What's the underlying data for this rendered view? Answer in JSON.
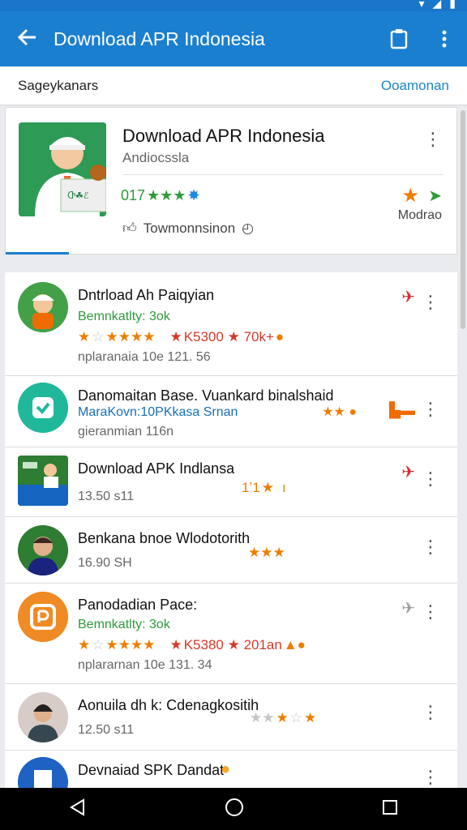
{
  "app_bar": {
    "title": "Download APR Indonesia"
  },
  "subbar": {
    "left": "Sageykanars",
    "right": "Ooamonan"
  },
  "featured": {
    "title": "Download APR Indonesia",
    "subtitle": "Andiocssla",
    "rating_text": "017",
    "meta_text": "Towmonnsinon",
    "action_label": "Modrao"
  },
  "apps": [
    {
      "name": "Dntrload Ah Paiqyian",
      "line2": "Bemnkatlty: 3ok",
      "stars_text": "K5300 ★ 70k+",
      "line4": "nplaranaia 10e 121. 56"
    },
    {
      "name": "Danomaitan Base. Vuankard binalshaid",
      "line2": "MaraKovn:10PKkasa Srnan",
      "line3": "gieranmian 116n"
    },
    {
      "name": "Download APK Indlansa",
      "line2": "13.50 s11",
      "stars_text": "1ʼ1"
    },
    {
      "name": "Benkana bnoe Wlodotorith",
      "line2": "16.90 SH"
    },
    {
      "name": "Panodadian Pace:",
      "line2": "Bemnkatlty: 3ok",
      "stars_text": "K5380 ★ 201an",
      "line4": "nplararnan 10e 131. 34"
    },
    {
      "name": "Aonuila dh k: Cdenagkositih",
      "line2": "12.50 s11"
    },
    {
      "name": "Devnaiad SPK Dandat"
    }
  ]
}
